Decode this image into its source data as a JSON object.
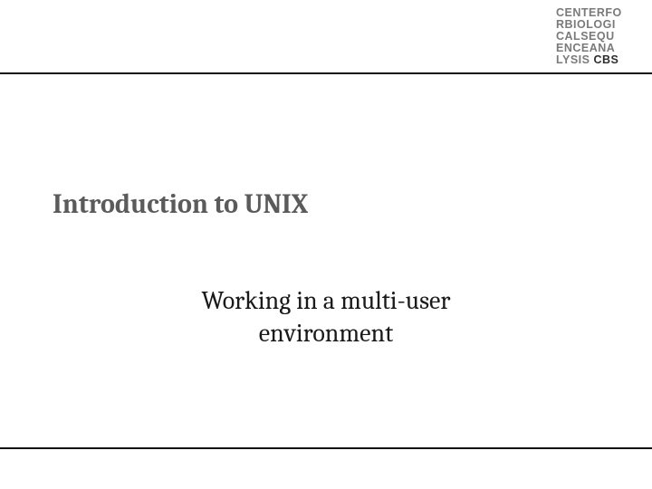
{
  "logo": {
    "line1": "CENTERFO",
    "line2": "RBIOLOGI",
    "line3": "CALSEQU",
    "line4": "ENCEANA",
    "line5_prefix": "LYSIS ",
    "line5_strong": "CBS"
  },
  "title": "Introduction to UNIX",
  "subtitle": "Working in a multi-user environment"
}
